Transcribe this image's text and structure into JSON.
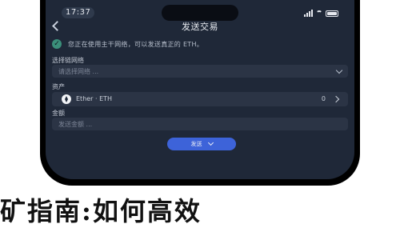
{
  "status_bar": {
    "time": "17:37",
    "battery_percent": 100
  },
  "header": {
    "title": "发送交易"
  },
  "notice": {
    "icon": "info-icon",
    "text": "您正在使用主干网络，可以发送真正的 ETH。"
  },
  "form": {
    "chain_label": "选择链网络",
    "chain_placeholder": "请选择网络 ...",
    "asset_label": "资产",
    "asset_name": "Ether · ETH",
    "asset_balance": "0",
    "amount_label": "金额",
    "amount_placeholder": "发送金额 ..."
  },
  "actions": {
    "submit_label": "发送"
  },
  "headline": "矿指南:如何高效"
}
